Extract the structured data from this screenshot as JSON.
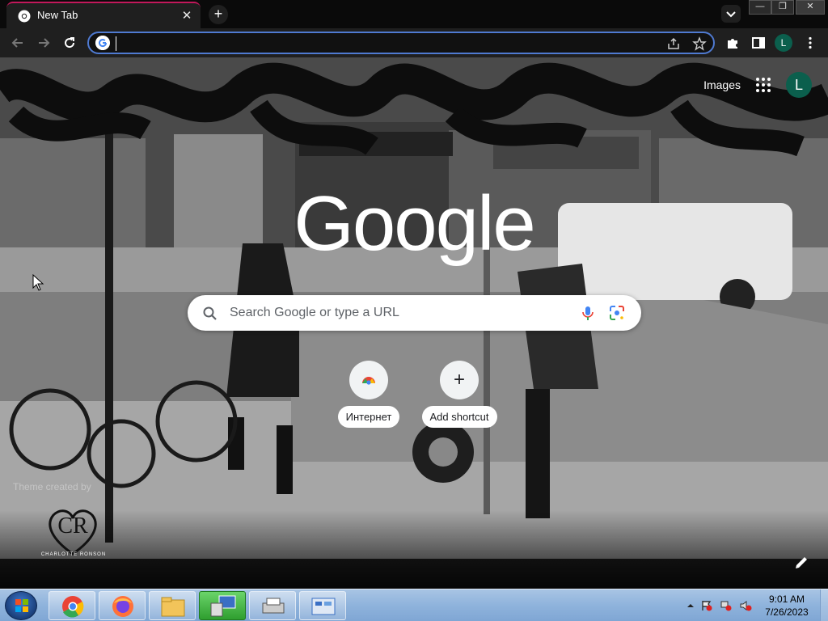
{
  "browser": {
    "tab": {
      "title": "New Tab",
      "close": "✕"
    },
    "newtab": "+",
    "window_controls": {
      "minimize": "—",
      "restore": "❐",
      "close": "✕"
    },
    "omnibox": {
      "value": "",
      "placeholder": ""
    },
    "profile_initial": "L"
  },
  "ntp": {
    "images_link": "Images",
    "avatar_initial": "L",
    "logo": "Google",
    "search_placeholder": "Search Google or type a URL",
    "shortcuts": [
      {
        "label": "Интернет"
      },
      {
        "label": "Add shortcut",
        "icon": "+"
      }
    ],
    "theme_credit": "Theme created by",
    "brand_name": "CHARLOTTE RONSON",
    "brand_mark": "CR"
  },
  "taskbar": {
    "clock_time": "9:01 AM",
    "clock_date": "7/26/2023",
    "items": [
      "chrome-icon",
      "firefox-icon",
      "file-explorer-icon",
      "network-tool-icon",
      "printer-icon",
      "control-panel-icon"
    ]
  },
  "colors": {
    "accent": "#4f7ad1",
    "avatar": "#0b5f4d",
    "tab_highlight": "#c2185b"
  }
}
